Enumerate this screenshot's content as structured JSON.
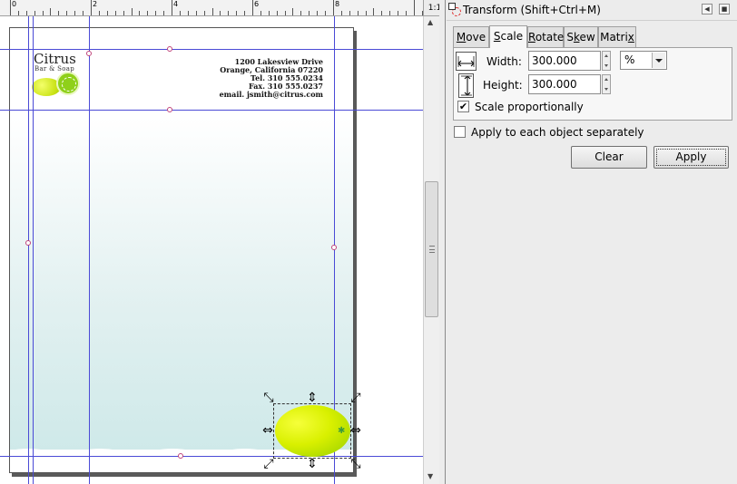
{
  "window": {
    "title": "Transform (Shift+Ctrl+M)"
  },
  "ruler": {
    "labels": [
      "0",
      "2",
      "4",
      "6",
      "8"
    ]
  },
  "zoom_corner": {
    "label": "1:1"
  },
  "letterhead": {
    "brand": "Citrus",
    "tagline": "Bar & Soap",
    "address_lines": [
      "1200 Lakesview Drive",
      "Orange, California 07220",
      "Tel. 310 555.0234",
      "Fax. 310 555.0237",
      "email. jsmith@citrus.com"
    ]
  },
  "tabs": [
    {
      "label": "Move",
      "key": "M"
    },
    {
      "label": "Scale",
      "key": "S",
      "active": true
    },
    {
      "label": "Rotate",
      "key": "R"
    },
    {
      "label": "Skew",
      "key": "k"
    },
    {
      "label": "Matrix",
      "key": "x"
    }
  ],
  "scale": {
    "width_label": "Width:",
    "width_value": "300.000",
    "height_label": "Height:",
    "height_value": "300.000",
    "unit": "%",
    "scale_proportionally_label": "Scale proportionally",
    "scale_proportionally_checked": true
  },
  "apply_each_label": "Apply to each object separately",
  "apply_each_checked": false,
  "buttons": {
    "clear": "Clear",
    "apply": "Apply"
  },
  "colors": {
    "guide": "#4a4ad6",
    "lemon": "#d9f000",
    "accent_marker": "#c0447a"
  }
}
